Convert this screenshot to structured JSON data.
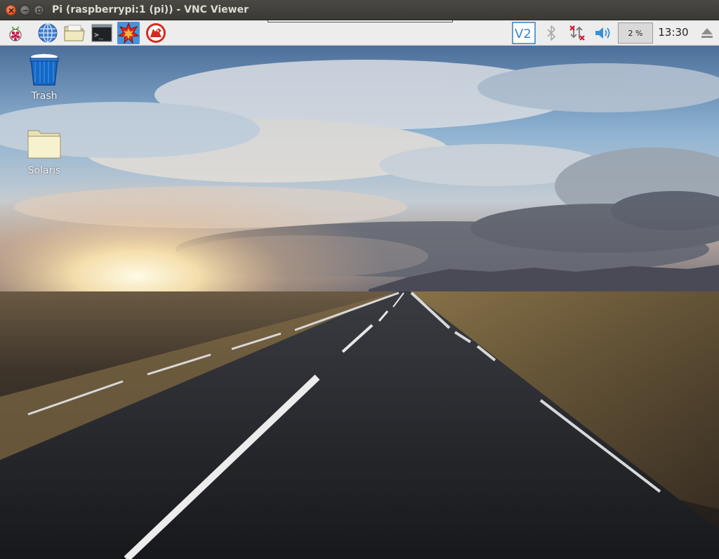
{
  "window": {
    "title": "Pi (raspberrypi:1 (pi)) - VNC Viewer",
    "controls": [
      "close-icon",
      "minimize-icon",
      "maximize-icon"
    ]
  },
  "panel": {
    "launchers": [
      {
        "name": "raspberry-menu",
        "icon": "raspberry-icon"
      },
      {
        "name": "web-browser",
        "icon": "globe-icon"
      },
      {
        "name": "file-manager",
        "icon": "folder-icon"
      },
      {
        "name": "terminal",
        "icon": "terminal-icon",
        "text": ">_"
      },
      {
        "name": "mathematica",
        "icon": "mathematica-icon",
        "active": true
      },
      {
        "name": "wolfram",
        "icon": "wolf-icon"
      }
    ],
    "tray": {
      "vnc_label": "V2",
      "bluetooth": "bluetooth-icon",
      "network": "network-disconnected-icon",
      "volume": "volume-icon",
      "cpu_usage": "2 %",
      "clock": "13:30",
      "eject": "eject-icon"
    }
  },
  "desktop": {
    "icons": [
      {
        "label": "Trash",
        "icon": "trash-icon"
      },
      {
        "label": "Solaris",
        "icon": "folder-icon"
      }
    ],
    "wallpaper": "road-sunset-wallpaper"
  },
  "colors": {
    "titlebar": "#3c3b37",
    "panel": "#ededed",
    "active_launcher": "#4a90d9",
    "close_button": "#e0531f"
  }
}
